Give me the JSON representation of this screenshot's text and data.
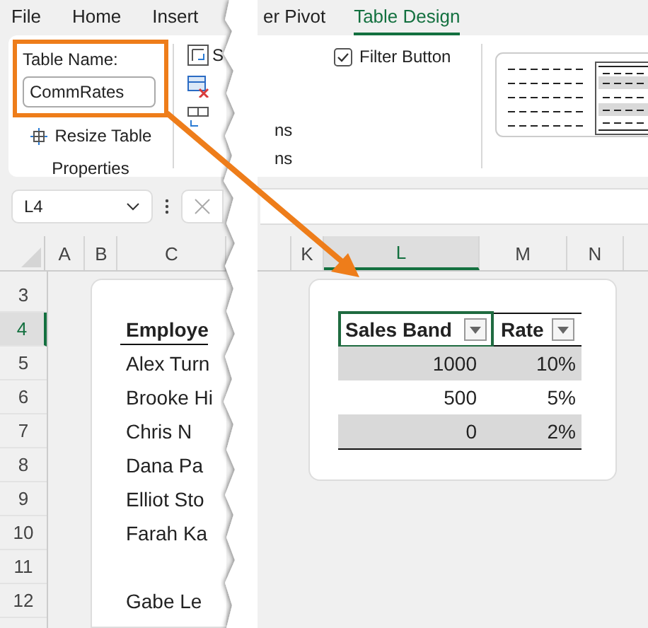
{
  "tabs_left": [
    {
      "label": "File",
      "selected": false
    },
    {
      "label": "Home",
      "selected": false
    },
    {
      "label": "Insert",
      "selected": false
    }
  ],
  "tabs_right": [
    {
      "label": "er Pivot",
      "selected": false
    },
    {
      "label": "Table Design",
      "selected": true
    }
  ],
  "properties_group": {
    "table_name_label": "Table Name:",
    "table_name_value": "CommRates",
    "resize_button": "Resize Table",
    "group_label": "Properties"
  },
  "tools_group": {
    "button_label": "S",
    "cut_labels": [
      "ns",
      "ns"
    ]
  },
  "style_options": {
    "filter_button": {
      "label": "Filter Button",
      "checked": true
    }
  },
  "name_box": {
    "value": "L4"
  },
  "left_sheet": {
    "columns": [
      {
        "label": "A",
        "selected": false
      },
      {
        "label": "B",
        "selected": false
      },
      {
        "label": "C",
        "selected": false
      }
    ],
    "rows": [
      {
        "number": "3",
        "selected": false
      },
      {
        "number": "4",
        "selected": true,
        "kind": "header",
        "cell": "Employe"
      },
      {
        "number": "5",
        "selected": false,
        "kind": "name",
        "cell": "Alex Turn"
      },
      {
        "number": "6",
        "selected": false,
        "kind": "name",
        "cell": "Brooke Hi"
      },
      {
        "number": "7",
        "selected": false,
        "kind": "name",
        "cell": "Chris N"
      },
      {
        "number": "8",
        "selected": false,
        "kind": "name",
        "cell": "Dana Pa"
      },
      {
        "number": "9",
        "selected": false,
        "kind": "name",
        "cell": "Elliot Sto"
      },
      {
        "number": "10",
        "selected": false,
        "kind": "name",
        "cell": "Farah Ka"
      },
      {
        "number": "11",
        "selected": false
      },
      {
        "number": "12",
        "selected": false,
        "kind": "name",
        "cell": "Gabe Le"
      }
    ]
  },
  "right_sheet": {
    "columns": [
      {
        "label": "K",
        "selected": false
      },
      {
        "label": "L",
        "selected": true
      },
      {
        "label": "M",
        "selected": false
      },
      {
        "label": "N",
        "selected": false
      }
    ],
    "table": {
      "columns": [
        {
          "label": "Sales Band",
          "selected": true
        },
        {
          "label": "Rate",
          "selected": false
        }
      ],
      "rows": [
        {
          "cells": [
            "1000",
            "10%"
          ],
          "banded": true
        },
        {
          "cells": [
            "500",
            "5%"
          ],
          "banded": false
        },
        {
          "cells": [
            "0",
            "2%"
          ],
          "banded": true
        }
      ]
    }
  }
}
